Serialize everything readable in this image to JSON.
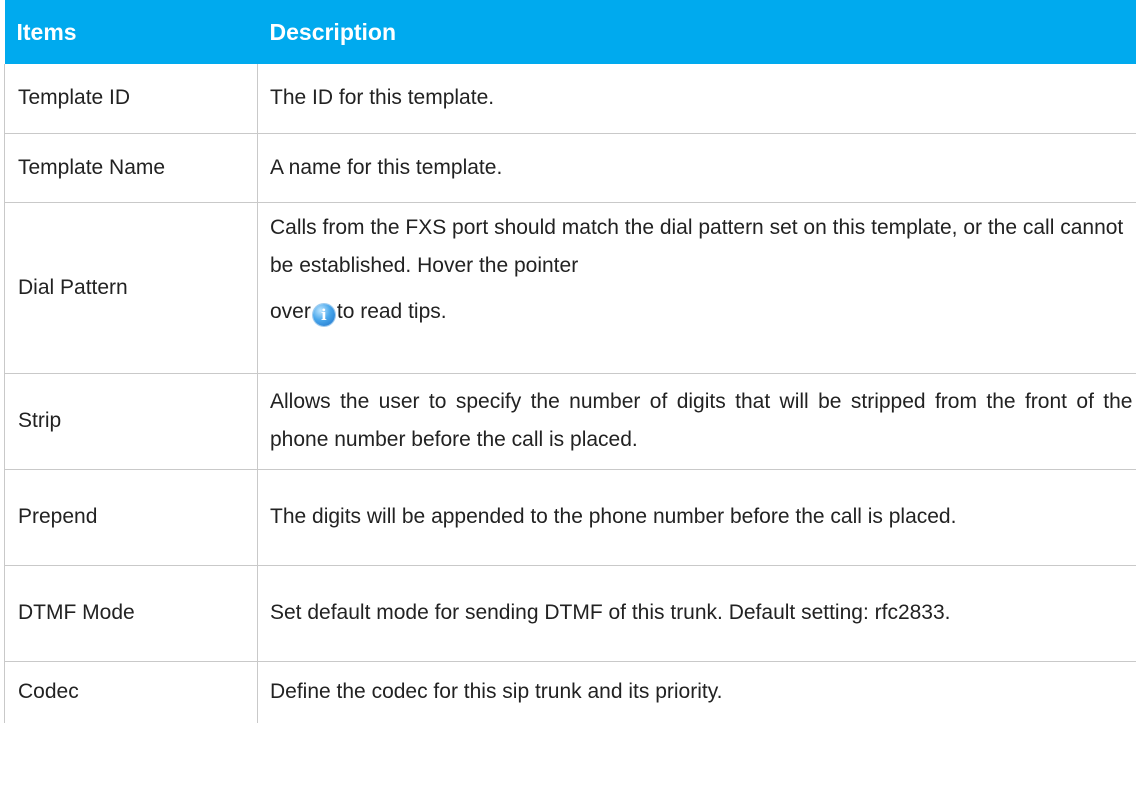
{
  "table": {
    "headers": {
      "items": "Items",
      "description": "Description"
    },
    "rows": [
      {
        "item": "Template ID",
        "description": "The ID for this template."
      },
      {
        "item": "Template Name",
        "description": "A name for this template."
      },
      {
        "item": "Dial Pattern",
        "description_part1": "Calls from the FXS port should match the dial pattern set on this template, or the call cannot be established. Hover the pointer",
        "description_part2": "over",
        "description_part3": "to read tips.",
        "icon": "info-icon"
      },
      {
        "item": "Strip",
        "description": "Allows the user to specify the number of digits that will be stripped from the front of the phone number before the call is placed."
      },
      {
        "item": "Prepend",
        "description": "The digits will be appended to the phone number before the call is placed."
      },
      {
        "item": "DTMF Mode",
        "description": "Set default mode for sending DTMF of this trunk. Default setting: rfc2833."
      },
      {
        "item": "Codec",
        "description": "Define the codec for this sip trunk and its priority."
      }
    ]
  },
  "colors": {
    "header_bg": "#00aaee",
    "header_text": "#ffffff",
    "border": "#c9c9c9",
    "text": "#222222"
  }
}
